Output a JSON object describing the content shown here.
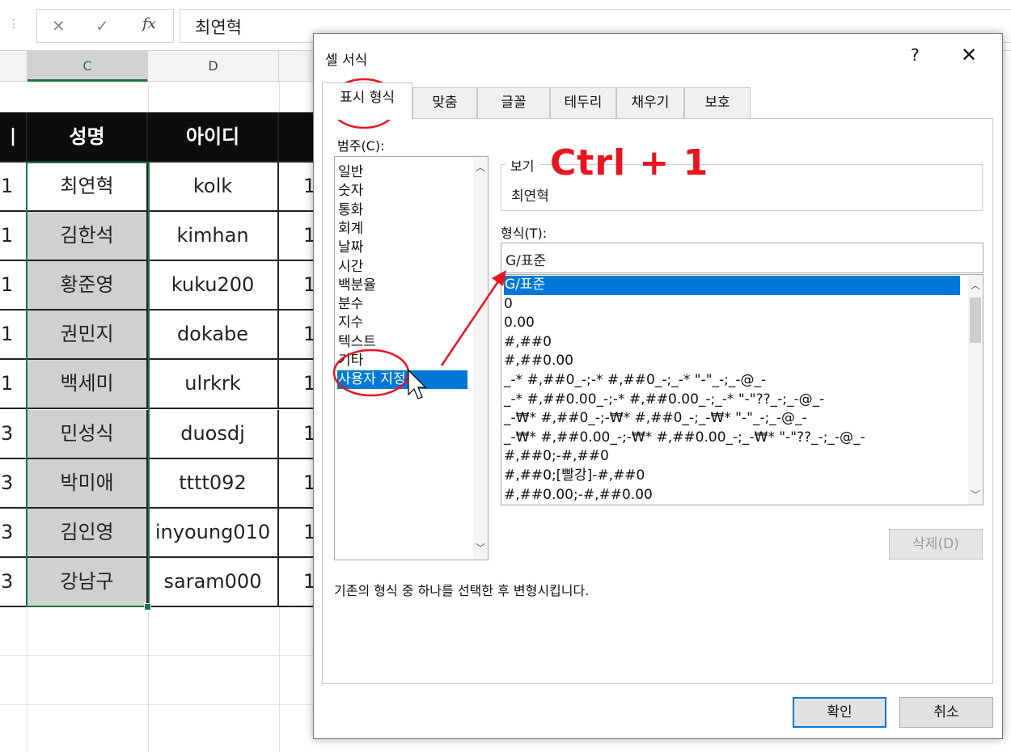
{
  "formula_bar": {
    "cancel_icon": "✕",
    "enter_icon": "✓",
    "fx_label": "fx",
    "value": "최연혁"
  },
  "columns": [
    {
      "label": "C",
      "selected": true
    },
    {
      "label": "D",
      "selected": false
    }
  ],
  "table": {
    "headers": [
      "성명",
      "아이디"
    ],
    "rows": [
      {
        "left": "1",
        "name": "최연혁",
        "id": "kolk",
        "right": "1"
      },
      {
        "left": "1",
        "name": "김한석",
        "id": "kimhan",
        "right": "1"
      },
      {
        "left": "1",
        "name": "황준영",
        "id": "kuku200",
        "right": "1"
      },
      {
        "left": "1",
        "name": "권민지",
        "id": "dokabe",
        "right": "1"
      },
      {
        "left": "1",
        "name": "백세미",
        "id": "ulrkrk",
        "right": "1"
      },
      {
        "left": "3",
        "name": "민성식",
        "id": "duosdj",
        "right": "1"
      },
      {
        "left": "3",
        "name": "박미애",
        "id": "tttt092",
        "right": "1"
      },
      {
        "left": "3",
        "name": "김인영",
        "id": "inyoung010",
        "right": "1"
      },
      {
        "left": "3",
        "name": "강남구",
        "id": "saram000",
        "right": "1"
      }
    ]
  },
  "dialog": {
    "title": "셀 서식",
    "help": "?",
    "close": "✕",
    "tabs": [
      "표시 형식",
      "맞춤",
      "글꼴",
      "테두리",
      "채우기",
      "보호"
    ],
    "category_label": "범주(C):",
    "categories": [
      "일반",
      "숫자",
      "통화",
      "회계",
      "날짜",
      "시간",
      "백분율",
      "분수",
      "지수",
      "텍스트",
      "기타",
      "사용자 지정"
    ],
    "selected_category": "사용자 지정",
    "preview_label": "보기",
    "preview_value": "최연혁",
    "format_label": "형식(T):",
    "format_value": "G/표준",
    "formats": [
      "G/표준",
      "0",
      "0.00",
      "#,##0",
      "#,##0.00",
      "_-* #,##0_-;-* #,##0_-;_-* \"-\"_-;_-@_-",
      "_-* #,##0.00_-;-* #,##0.00_-;_-* \"-\"??_-;_-@_-",
      "_-₩* #,##0_-;-₩* #,##0_-;_-₩* \"-\"_-;_-@_-",
      "_-₩* #,##0.00_-;-₩* #,##0.00_-;_-₩* \"-\"??_-;_-@_-",
      "#,##0;-#,##0",
      "#,##0;[빨강]-#,##0",
      "#,##0.00;-#,##0.00"
    ],
    "delete_button": "삭제(D)",
    "description": "기존의 형식 중 하나를 선택한 후 변형시킵니다.",
    "ok_button": "확인",
    "cancel_button": "취소"
  },
  "annotation": {
    "text": "Ctrl + 1",
    "color": "#e8141e"
  }
}
